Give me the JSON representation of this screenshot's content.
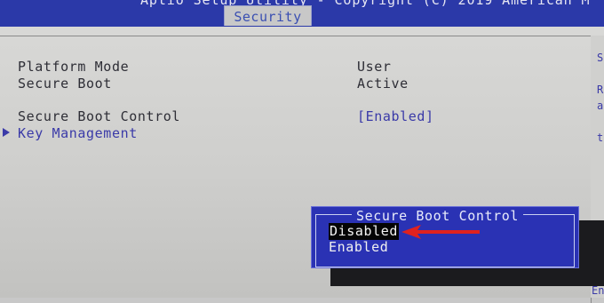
{
  "header": {
    "title": "Aptio Setup Utility - Copyright (C) 2019 American M",
    "active_tab": "Security"
  },
  "settings": {
    "platform_mode": {
      "label": "Platform Mode",
      "value": "User"
    },
    "secure_boot": {
      "label": "Secure Boot",
      "value": "Active"
    },
    "secure_boot_control": {
      "label": "Secure Boot Control",
      "value": "[Enabled]"
    },
    "key_management": {
      "label": "Key Management"
    }
  },
  "popup": {
    "title": "Secure Boot Control",
    "options": [
      "Disabled",
      "Enabled"
    ],
    "selected": "Disabled"
  },
  "help_panel": {
    "fragments": [
      "S",
      "R",
      "a",
      "t"
    ]
  },
  "footer_fragment": "En",
  "colors": {
    "bios_blue": "#2a32b4",
    "panel_gray": "#c8c8c8",
    "annotation_red": "#e0221f",
    "highlight_text": "#3a3aa8"
  }
}
